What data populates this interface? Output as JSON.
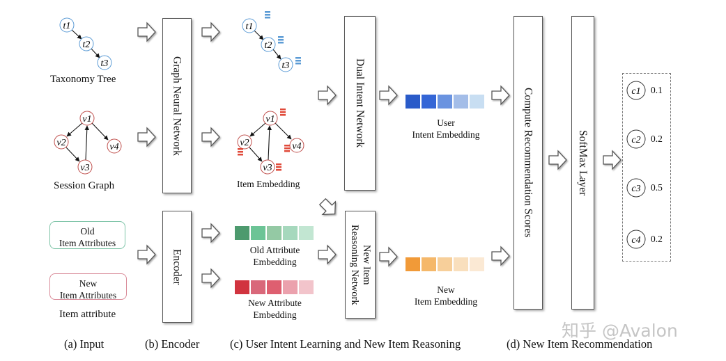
{
  "input": {
    "taxonomy_nodes": [
      "t1",
      "t2",
      "t3"
    ],
    "taxonomy_label": "Taxonomy Tree",
    "session_nodes": [
      "v1",
      "v2",
      "v3",
      "v4"
    ],
    "session_label": "Session Graph",
    "old_attr_line1": "Old",
    "old_attr_line2": "Item Attributes",
    "new_attr_line1": "New",
    "new_attr_line2": "Item Attributes",
    "attr_label": "Item attribute"
  },
  "encoder": {
    "gnn_label": "Graph Neural Network",
    "encoder_label": "Encoder"
  },
  "intent": {
    "item_embedding_label": "Item Embedding",
    "old_attr_emb_line1": "Old Attribute",
    "old_attr_emb_line2": "Embedding",
    "new_attr_emb_line1": "New Attribute",
    "new_attr_emb_line2": "Embedding",
    "dual_intent_label": "Dual Intent Network",
    "nir_line1": "New Item",
    "nir_line2": "Reasoning  Network",
    "user_intent_line1": "User",
    "user_intent_line2": "Intent Embedding",
    "new_item_emb_line1": "New",
    "new_item_emb_line2": "Item Embedding"
  },
  "recommendation": {
    "compute_label": "Compute Recommendation Scores",
    "softmax_label": "SoftMax Layer",
    "candidates": [
      {
        "name": "c1",
        "score": "0.1"
      },
      {
        "name": "c2",
        "score": "0.2"
      },
      {
        "name": "c3",
        "score": "0.5"
      },
      {
        "name": "c4",
        "score": "0.2"
      }
    ]
  },
  "colors": {
    "taxonomy": "#5b9bd5",
    "session": "#c0504d",
    "user_intent": [
      "#2a5bc9",
      "#3466d6",
      "#6a93e0",
      "#a3bde8",
      "#c8def2"
    ],
    "old_attr": [
      "#4d9a6e",
      "#6cc496",
      "#94c9a4",
      "#a6d8bd",
      "#c2e6d2"
    ],
    "new_attr": [
      "#d1343f",
      "#d9687a",
      "#de5f70",
      "#eba1ad",
      "#f2c4cb"
    ],
    "new_item": [
      "#f19a38",
      "#f5b86a",
      "#f7cf9a",
      "#f9dfbd",
      "#fbe9d4"
    ]
  },
  "captions": {
    "a": "(a) Input",
    "b": "(b) Encoder",
    "c": "(c) User Intent Learning and New Item Reasoning",
    "d": "(d) New Item Recommendation"
  },
  "watermark": "知乎 @Avalon"
}
